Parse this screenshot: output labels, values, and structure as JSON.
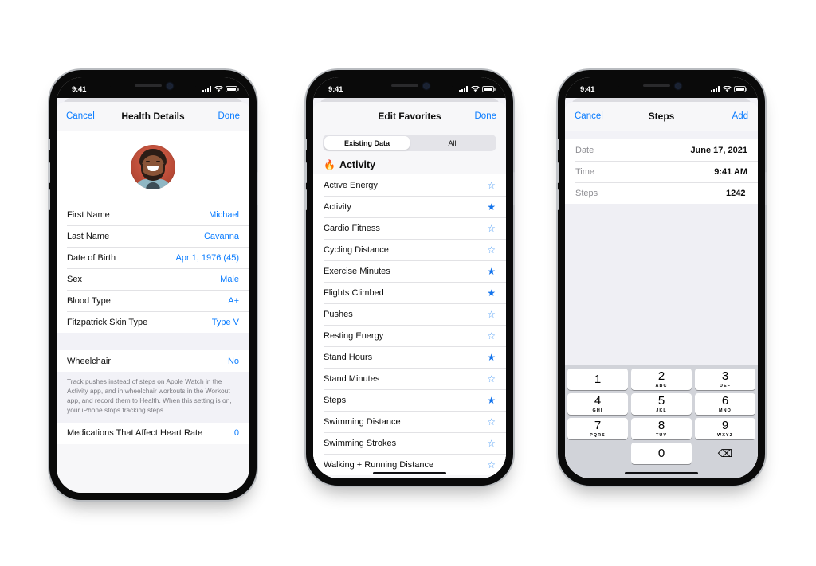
{
  "meta": {
    "background_color": "#ffffff",
    "accent_blue": "#0a7cff",
    "flame_color": "#f0482c"
  },
  "status_bar": {
    "time": "9:41",
    "cellular_icon": "cellular-bars-icon",
    "wifi_icon": "wifi-icon",
    "battery_icon": "battery-full-icon"
  },
  "phone1": {
    "nav": {
      "cancel_label": "Cancel",
      "title": "Health Details",
      "done_label": "Done"
    },
    "avatar_alt": "user-profile-photo",
    "details": [
      {
        "label": "First Name",
        "value": "Michael"
      },
      {
        "label": "Last Name",
        "value": "Cavanna"
      },
      {
        "label": "Date of Birth",
        "value": "Apr 1, 1976 (45)"
      },
      {
        "label": "Sex",
        "value": "Male"
      },
      {
        "label": "Blood Type",
        "value": "A+"
      },
      {
        "label": "Fitzpatrick Skin Type",
        "value": "Type V"
      }
    ],
    "wheelchair": {
      "label": "Wheelchair",
      "value": "No"
    },
    "footnote": "Track pushes instead of steps on Apple Watch in the Activity app, and in wheelchair workouts in the Workout app, and record them to Health. When this setting is on, your iPhone stops tracking steps.",
    "medications": {
      "label": "Medications That Affect Heart Rate",
      "value": "0"
    }
  },
  "phone2": {
    "nav": {
      "title": "Edit Favorites",
      "done_label": "Done"
    },
    "segments": [
      {
        "label": "Existing Data",
        "selected": true
      },
      {
        "label": "All",
        "selected": false
      }
    ],
    "section": {
      "icon": "flame-icon",
      "title": "Activity"
    },
    "items": [
      {
        "label": "Active Energy",
        "favorite": false
      },
      {
        "label": "Activity",
        "favorite": true
      },
      {
        "label": "Cardio Fitness",
        "favorite": false
      },
      {
        "label": "Cycling Distance",
        "favorite": false
      },
      {
        "label": "Exercise Minutes",
        "favorite": true
      },
      {
        "label": "Flights Climbed",
        "favorite": true
      },
      {
        "label": "Pushes",
        "favorite": false
      },
      {
        "label": "Resting Energy",
        "favorite": false
      },
      {
        "label": "Stand Hours",
        "favorite": true
      },
      {
        "label": "Stand Minutes",
        "favorite": false
      },
      {
        "label": "Steps",
        "favorite": true
      },
      {
        "label": "Swimming Distance",
        "favorite": false
      },
      {
        "label": "Swimming Strokes",
        "favorite": false
      },
      {
        "label": "Walking + Running Distance",
        "favorite": false
      }
    ]
  },
  "phone3": {
    "nav": {
      "cancel_label": "Cancel",
      "title": "Steps",
      "add_label": "Add"
    },
    "fields": [
      {
        "label": "Date",
        "value": "June 17, 2021"
      },
      {
        "label": "Time",
        "value": "9:41 AM"
      },
      {
        "label": "Steps",
        "value": "1242",
        "focused": true
      }
    ],
    "keypad": {
      "keys": [
        {
          "num": "1",
          "letters": ""
        },
        {
          "num": "2",
          "letters": "ABC"
        },
        {
          "num": "3",
          "letters": "DEF"
        },
        {
          "num": "4",
          "letters": "GHI"
        },
        {
          "num": "5",
          "letters": "JKL"
        },
        {
          "num": "6",
          "letters": "MNO"
        },
        {
          "num": "7",
          "letters": "PQRS"
        },
        {
          "num": "8",
          "letters": "TUV"
        },
        {
          "num": "9",
          "letters": "WXYZ"
        },
        {
          "num": "0",
          "letters": ""
        }
      ],
      "delete_icon": "delete-backward-icon",
      "delete_glyph": "⌫"
    }
  }
}
